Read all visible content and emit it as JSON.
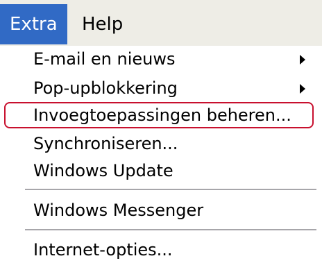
{
  "menubar": {
    "items": [
      {
        "label": "Extra",
        "active": true
      },
      {
        "label": "Help",
        "active": false
      }
    ]
  },
  "menu": {
    "items": [
      {
        "label": "E-mail en nieuws",
        "submenu": true
      },
      {
        "label": "Pop-upblokkering",
        "submenu": true
      },
      {
        "label": "Invoegtoepassingen beheren...",
        "submenu": false,
        "highlighted": true
      },
      {
        "label": "Synchroniseren...",
        "submenu": false
      },
      {
        "label": "Windows Update",
        "submenu": false
      },
      {
        "label": "Windows Messenger",
        "submenu": false
      },
      {
        "label": "Internet-opties...",
        "submenu": false
      }
    ]
  },
  "colors": {
    "menubar_bg": "#eeede6",
    "active_bg": "#316ac5",
    "highlight_border": "#c8102e",
    "separator": "#a7a6aa"
  }
}
